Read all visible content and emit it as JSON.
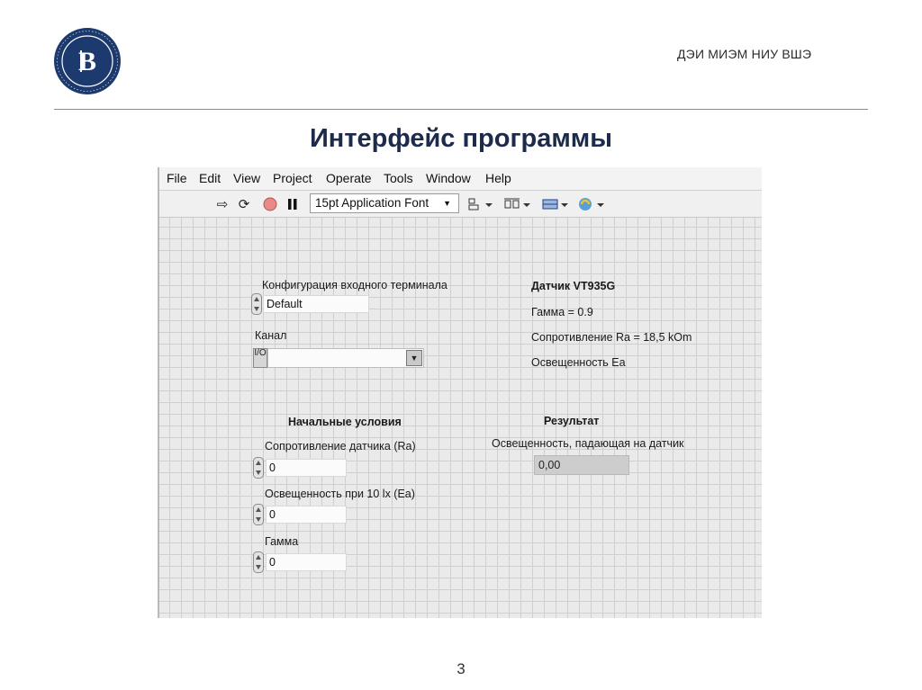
{
  "header": {
    "org": "ДЭИ МИЭМ НИУ ВШЭ"
  },
  "slide": {
    "title": "Интерфейс программы",
    "number": "3"
  },
  "menubar": [
    "File",
    "Edit",
    "View",
    "Project",
    "Operate",
    "Tools",
    "Window",
    "Help"
  ],
  "toolbar": {
    "font": "15pt Application Font"
  },
  "panel": {
    "terminal_config_label": "Конфигурация входного терминала",
    "terminal_config_value": "Default",
    "channel_label": "Канал",
    "channel_ring_glyph": "I/O",
    "sensor": {
      "title": "Датчик VT935G",
      "gamma": "Гамма = 0.9",
      "resistance": "Сопротивление Ra = 18,5 kOm",
      "illuminance": "Освещенность  Ea"
    },
    "initial": {
      "title": "Начальные условия",
      "resistance_label": "Сопротивление датчика (Ra)",
      "resistance_value": "0",
      "illuminance_label": "Освещенность при 10 lx (Ea)",
      "illuminance_value": "0",
      "gamma_label": "Гамма",
      "gamma_value": "0"
    },
    "result": {
      "title": "Результат",
      "label": "Освещенность, падающая на датчик",
      "value": "0,00"
    }
  },
  "colors": {
    "title": "#1d2a4a",
    "logo": "#1d3a6e"
  }
}
